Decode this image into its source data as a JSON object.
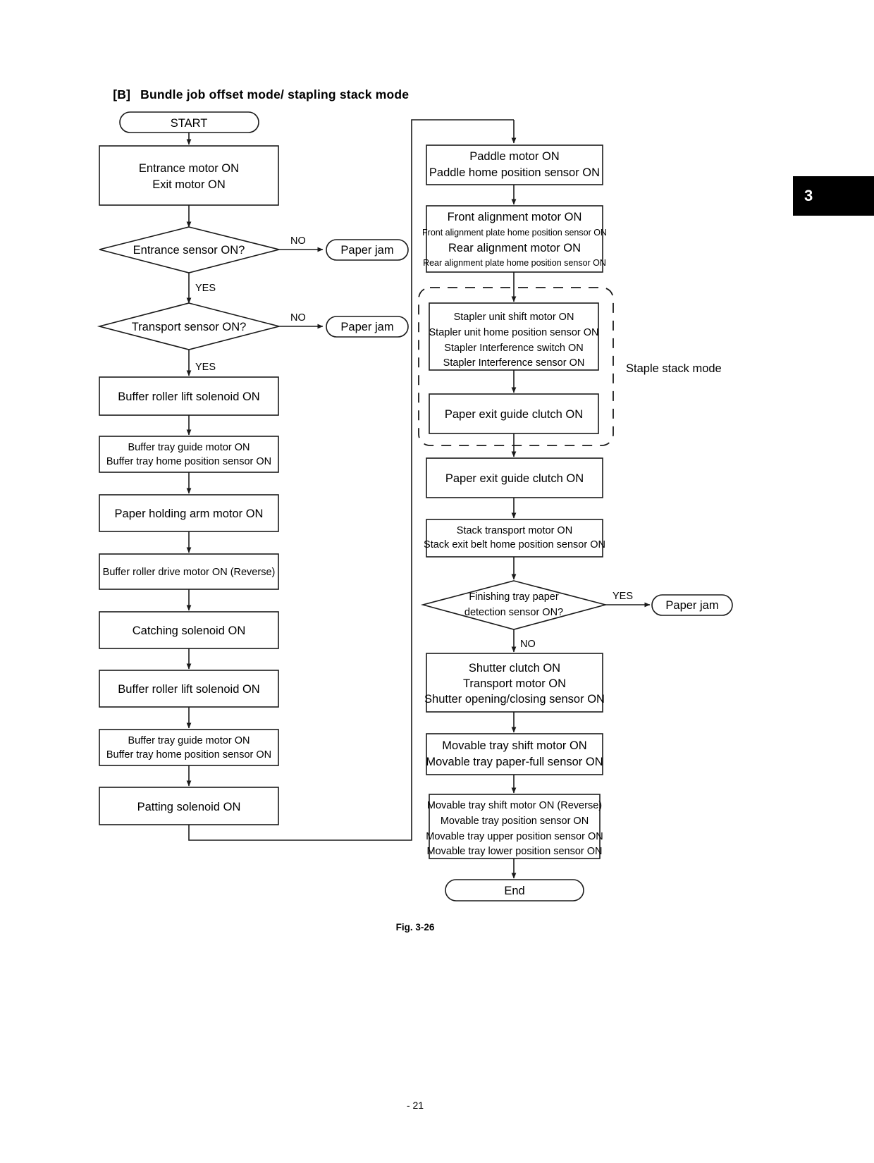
{
  "document": {
    "section_tag": "[B]",
    "section_title": "Bundle job offset mode/ stapling stack mode",
    "chapter_tab": "3",
    "figure_caption": "Fig. 3-26",
    "page_number": "- 21"
  },
  "chart_data": {
    "type": "diagram",
    "title": "Bundle job offset mode/ stapling stack mode",
    "diagram_kind": "flowchart",
    "nodes": [
      {
        "id": "start",
        "shape": "terminator",
        "lines": [
          "START"
        ]
      },
      {
        "id": "entrance_motor",
        "shape": "process",
        "lines": [
          "Entrance motor ON",
          "Exit motor ON"
        ]
      },
      {
        "id": "entrance_sensor",
        "shape": "decision",
        "lines": [
          "Entrance sensor ON?"
        ]
      },
      {
        "id": "jam1",
        "shape": "terminator",
        "lines": [
          "Paper jam"
        ]
      },
      {
        "id": "transport_sensor",
        "shape": "decision",
        "lines": [
          "Transport sensor ON?"
        ]
      },
      {
        "id": "jam2",
        "shape": "terminator",
        "lines": [
          "Paper jam"
        ]
      },
      {
        "id": "buffer_roller_lift_1",
        "shape": "process",
        "lines": [
          "Buffer roller lift solenoid ON"
        ]
      },
      {
        "id": "buffer_tray_guide_1",
        "shape": "process",
        "lines": [
          "Buffer tray guide motor ON",
          "Buffer tray home position sensor ON"
        ]
      },
      {
        "id": "paper_holding_arm",
        "shape": "process",
        "lines": [
          "Paper holding arm motor ON"
        ]
      },
      {
        "id": "buffer_roller_drive",
        "shape": "process",
        "lines": [
          "Buffer roller drive motor ON (Reverse)"
        ]
      },
      {
        "id": "catching_solenoid",
        "shape": "process",
        "lines": [
          "Catching solenoid ON"
        ]
      },
      {
        "id": "buffer_roller_lift_2",
        "shape": "process",
        "lines": [
          "Buffer roller lift solenoid ON"
        ]
      },
      {
        "id": "buffer_tray_guide_2",
        "shape": "process",
        "lines": [
          "Buffer tray guide motor ON",
          "Buffer tray home position sensor ON"
        ]
      },
      {
        "id": "patting_solenoid",
        "shape": "process",
        "lines": [
          "Patting solenoid ON"
        ]
      },
      {
        "id": "paddle_motor",
        "shape": "process",
        "lines": [
          "Paddle motor ON",
          "Paddle home position sensor ON"
        ]
      },
      {
        "id": "alignment_motors",
        "shape": "process",
        "lines": [
          "Front alignment motor ON",
          "Front alignment plate home position sensor ON",
          "Rear alignment motor ON",
          "Rear alignment plate home position sensor ON"
        ]
      },
      {
        "id": "stapler_unit",
        "shape": "process",
        "lines": [
          "Stapler unit shift motor ON",
          "Stapler unit home position sensor ON",
          "Stapler Interference switch ON",
          "Stapler Interference sensor ON"
        ]
      },
      {
        "id": "paper_exit_clutch_1",
        "shape": "process",
        "lines": [
          "Paper exit guide clutch ON"
        ]
      },
      {
        "id": "paper_exit_clutch_2",
        "shape": "process",
        "lines": [
          "Paper exit guide clutch ON"
        ]
      },
      {
        "id": "stack_transport",
        "shape": "process",
        "lines": [
          "Stack transport motor ON",
          "Stack exit belt home position sensor ON"
        ]
      },
      {
        "id": "finishing_tray_sensor",
        "shape": "decision",
        "lines": [
          "Finishing tray paper",
          "detection sensor ON?"
        ]
      },
      {
        "id": "jam3",
        "shape": "terminator",
        "lines": [
          "Paper jam"
        ]
      },
      {
        "id": "shutter_clutch",
        "shape": "process",
        "lines": [
          "Shutter clutch ON",
          "Transport motor ON",
          "Shutter opening/closing sensor ON"
        ]
      },
      {
        "id": "movable_tray_shift",
        "shape": "process",
        "lines": [
          "Movable tray shift motor ON",
          "Movable tray paper-full sensor ON"
        ]
      },
      {
        "id": "movable_tray_reverse",
        "shape": "process",
        "lines": [
          "Movable tray shift motor ON (Reverse)",
          "Movable tray position sensor  ON",
          "Movable tray upper position sensor  ON",
          "Movable tray lower position sensor ON"
        ]
      },
      {
        "id": "end",
        "shape": "terminator",
        "lines": [
          "End"
        ]
      }
    ],
    "edge_labels": {
      "entrance_sensor_no": "NO",
      "entrance_sensor_yes": "YES",
      "transport_sensor_no": "NO",
      "transport_sensor_yes": "YES",
      "finishing_tray_yes": "YES",
      "finishing_tray_no": "NO"
    },
    "group_label": "Staple stack mode"
  },
  "nodes": {
    "start": "START",
    "entrance_motor_l1": "Entrance motor ON",
    "entrance_motor_l2": "Exit motor ON",
    "entrance_sensor": "Entrance sensor ON?",
    "jam1": "Paper jam",
    "transport_sensor": "Transport sensor ON?",
    "jam2": "Paper jam",
    "buffer_roller_lift_1": "Buffer roller lift solenoid ON",
    "buffer_tray_guide_1_l1": "Buffer tray guide motor ON",
    "buffer_tray_guide_1_l2": "Buffer tray home position sensor ON",
    "paper_holding_arm": "Paper holding arm motor ON",
    "buffer_roller_drive": "Buffer roller drive motor ON (Reverse)",
    "catching_solenoid": "Catching solenoid ON",
    "buffer_roller_lift_2": "Buffer roller lift solenoid ON",
    "buffer_tray_guide_2_l1": "Buffer tray guide motor ON",
    "buffer_tray_guide_2_l2": "Buffer tray home position sensor ON",
    "patting_solenoid": "Patting solenoid ON",
    "paddle_l1": "Paddle motor ON",
    "paddle_l2": "Paddle home position sensor ON",
    "align_l1": "Front alignment motor ON",
    "align_l2": "Front alignment plate home position sensor ON",
    "align_l3": "Rear alignment motor ON",
    "align_l4": "Rear alignment plate home position sensor ON",
    "stapler_l1": "Stapler unit shift motor ON",
    "stapler_l2": "Stapler unit home position sensor ON",
    "stapler_l3": "Stapler Interference switch ON",
    "stapler_l4": "Stapler Interference sensor ON",
    "paper_exit_clutch_1": "Paper exit guide clutch ON",
    "paper_exit_clutch_2": "Paper exit guide clutch ON",
    "stack_transport_l1": "Stack transport motor ON",
    "stack_transport_l2": "Stack exit belt home position sensor ON",
    "finishing_tray_l1": "Finishing tray paper",
    "finishing_tray_l2": "detection sensor ON?",
    "jam3": "Paper jam",
    "shutter_l1": "Shutter clutch ON",
    "shutter_l2": "Transport motor ON",
    "shutter_l3": "Shutter opening/closing sensor ON",
    "movable_shift_l1": "Movable tray shift motor ON",
    "movable_shift_l2": "Movable tray paper-full sensor ON",
    "movable_rev_l1": "Movable tray shift motor ON (Reverse)",
    "movable_rev_l2": "Movable tray position sensor  ON",
    "movable_rev_l3": "Movable tray upper position sensor  ON",
    "movable_rev_l4": "Movable tray lower position sensor ON",
    "end": "End"
  },
  "labels": {
    "no_1": "NO",
    "yes_1": "YES",
    "no_2": "NO",
    "yes_2": "YES",
    "yes_3": "YES",
    "no_3": "NO",
    "staple_stack_mode": "Staple stack mode"
  },
  "colors": {
    "stroke": "#1a1a1a",
    "background": "#ffffff",
    "tab_background": "#000000",
    "tab_text": "#ffffff"
  }
}
